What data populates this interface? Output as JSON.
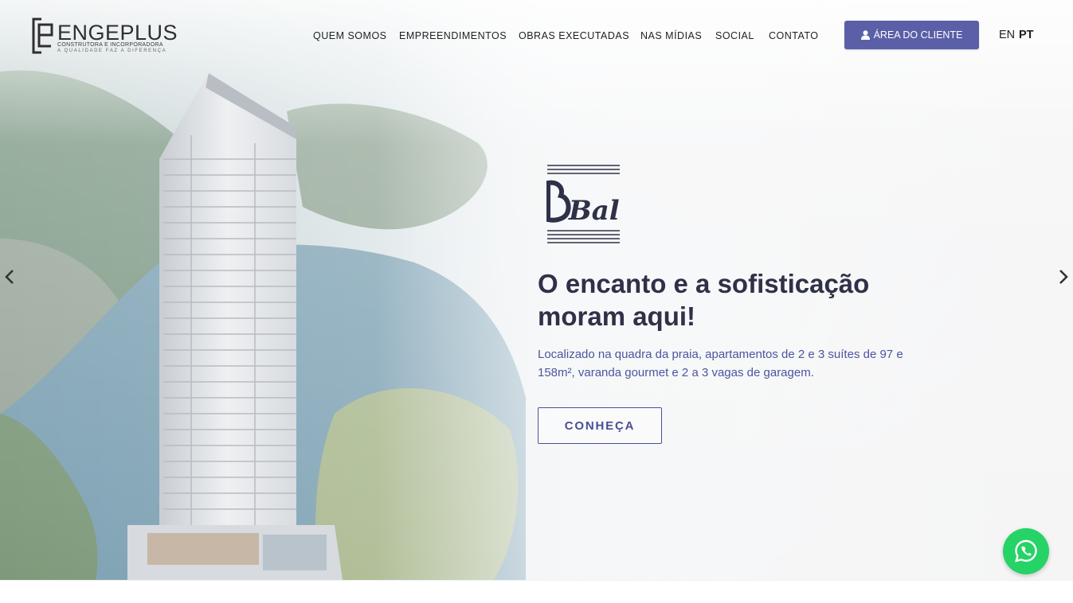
{
  "brand": {
    "name": "ENGEPLUS",
    "subtitle": "CONSTRUTORA E INCORPORADORA",
    "tagline": "A QUALIDADE FAZ A DIFERENÇA"
  },
  "nav": {
    "items": [
      {
        "label": "QUEM SOMOS"
      },
      {
        "label": "EMPREENDIMENTOS"
      },
      {
        "label": "OBRAS EXECUTADAS"
      },
      {
        "label": "NAS MÍDIAS"
      },
      {
        "label": "SOCIAL"
      },
      {
        "label": "CONTATO"
      }
    ],
    "client_button": "ÁREA DO CLIENTE",
    "lang_en": "EN",
    "lang_pt": "PT"
  },
  "hero": {
    "project_logo_text": "Bali",
    "headline_line1": "O encanto e a sofisticação",
    "headline_line2": "moram aqui!",
    "description_line1": "Localizado na quadra da praia, apartamentos de 2 e 3 suítes de 97 e",
    "description_line2": "158m², varanda gourmet e 2 a 3 vagas de garagem.",
    "cta_label": "CONHEÇA"
  },
  "icons": {
    "prev": "chevron-left-icon",
    "next": "chevron-right-icon",
    "user": "user-icon",
    "whatsapp": "whatsapp-icon"
  },
  "colors": {
    "accent": "#5a5fa8",
    "headline": "#2e3148",
    "description": "#4b55a0",
    "whatsapp": "#25d366"
  }
}
